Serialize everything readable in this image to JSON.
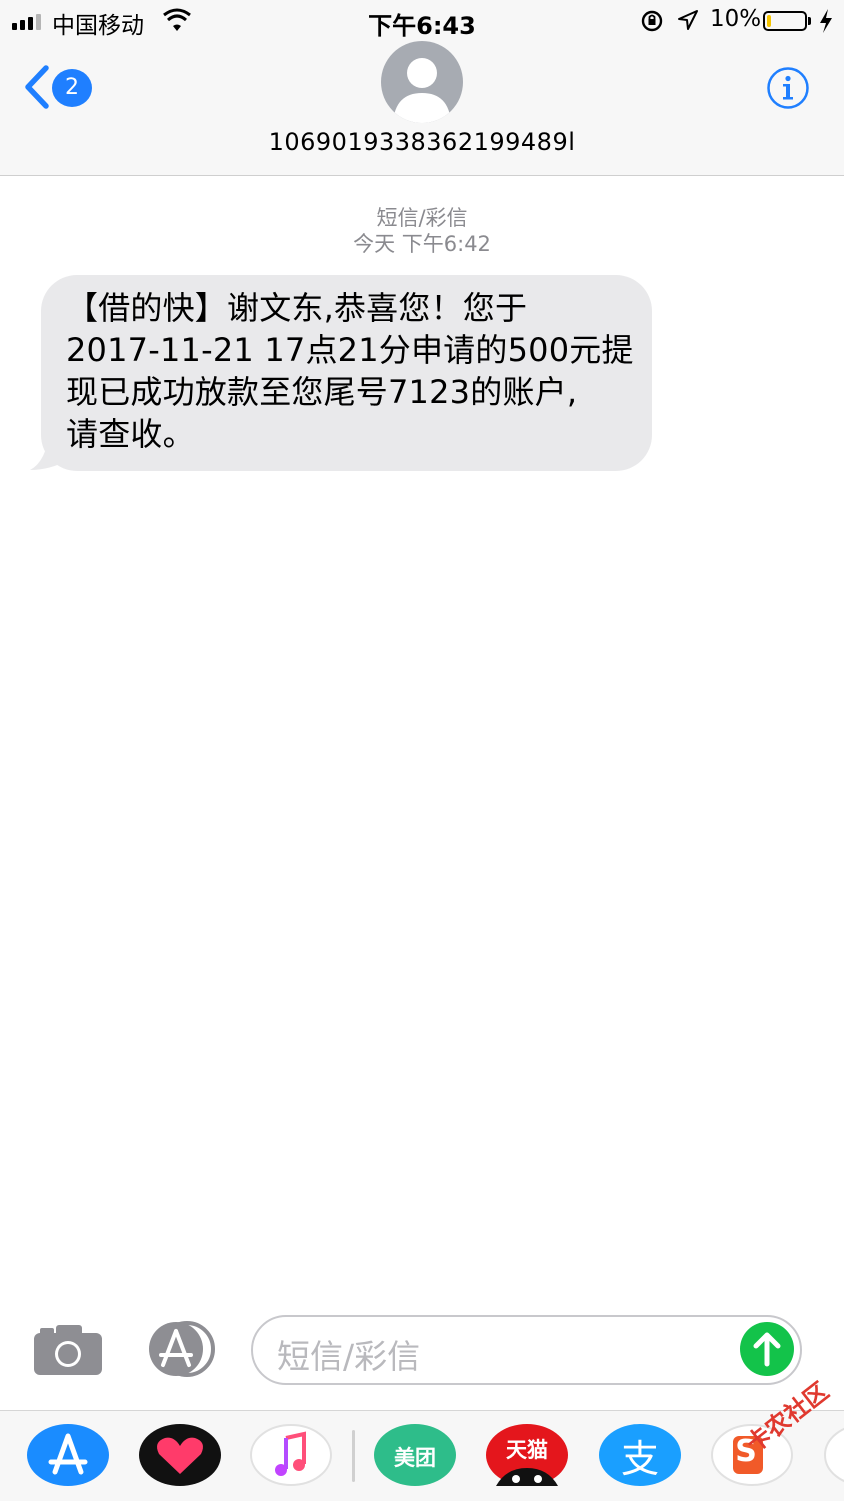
{
  "status_bar": {
    "carrier": "中国移动",
    "time": "下午6:43",
    "battery_percent": "10%",
    "battery_level": 0.1,
    "icons": [
      "signal-icon",
      "wifi-icon",
      "orientation-lock-icon",
      "location-icon",
      "battery-icon",
      "charging-bolt-icon"
    ]
  },
  "header": {
    "back_badge": "2",
    "sender_number": "1069019338362199489l",
    "icons": [
      "back-chevron-icon",
      "contact-avatar-icon",
      "info-icon"
    ]
  },
  "conversation": {
    "service_label": "短信/彩信",
    "timestamp": "今天 下午6:42",
    "message_lines": [
      "【借的快】谢文东,恭喜您！您于",
      "2017-11-21 17点21分申请的500元提",
      "现已成功放款至您尾号7123的账户,",
      "请查收。"
    ]
  },
  "composer": {
    "placeholder": "短信/彩信",
    "icons": [
      "camera-icon",
      "app-store-icon",
      "send-arrow-icon"
    ]
  },
  "app_drawer": {
    "apps": [
      {
        "name": "App Store",
        "icon": "app-store-icon",
        "color": "#1a8cff"
      },
      {
        "name": "Digital Touch",
        "icon": "heart-icon",
        "color": "#111111"
      },
      {
        "name": "Music",
        "icon": "music-note-icon",
        "color": "#f2f2f2"
      },
      {
        "name": "美团",
        "icon": "meituan-icon",
        "color": "#2ebd8a"
      },
      {
        "name": "天猫",
        "icon": "tmall-icon",
        "color": "#e4161c"
      },
      {
        "name": "支",
        "icon": "alipay-icon",
        "color": "#1a9fff"
      },
      {
        "name": "S",
        "icon": "sogou-icon",
        "color": "#f2f2f2"
      }
    ],
    "watermark": "卡农社区"
  }
}
